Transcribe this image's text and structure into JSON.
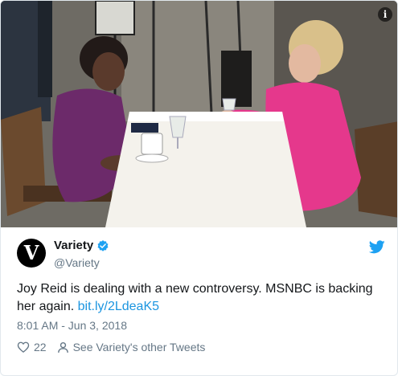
{
  "tweet": {
    "display_name": "Variety",
    "handle": "@Variety",
    "avatar_letter": "V",
    "text": "Joy Reid is dealing with a new controversy. MSNBC is backing her again. ",
    "link_text": "bit.ly/2LdeaK5",
    "timestamp": "8:01 AM - Jun 3, 2018",
    "like_count": "22",
    "other_tweets_label": "See Variety's other Tweets"
  },
  "media": {
    "info_label": "i"
  },
  "colors": {
    "link": "#1b95e0",
    "verified": "#1da1f2",
    "twitter_bird": "#1da1f2",
    "muted": "#657786",
    "text": "#14171a"
  },
  "icons": [
    "info-icon",
    "verified-badge-icon",
    "twitter-bird-icon",
    "heart-icon",
    "person-icon"
  ]
}
